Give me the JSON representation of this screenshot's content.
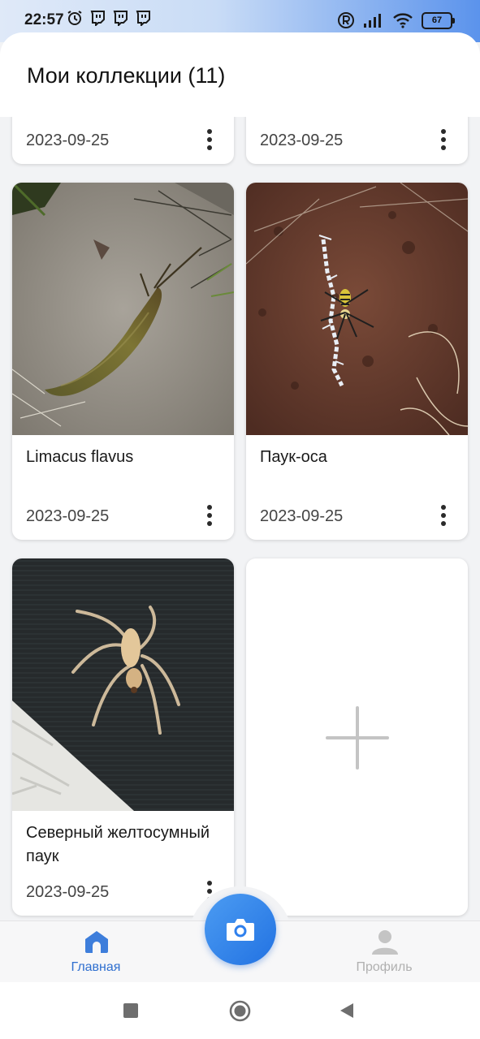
{
  "status_bar": {
    "time": "22:57",
    "battery": "67",
    "left_icons": [
      "alarm-icon",
      "twitch-icon",
      "twitch-icon",
      "twitch-icon"
    ],
    "right_icons": [
      "registered-icon",
      "signal-icon",
      "wifi-icon",
      "battery-icon"
    ]
  },
  "header": {
    "title": "Мои коллекции (11)"
  },
  "collections": [
    {
      "name": "",
      "date": "2023-09-25",
      "photo": "none"
    },
    {
      "name": "",
      "date": "2023-09-25",
      "photo": "none"
    },
    {
      "name": "Limacus flavus",
      "date": "2023-09-25",
      "photo": "slug"
    },
    {
      "name": "Паук-оса",
      "date": "2023-09-25",
      "photo": "wasp-spider"
    },
    {
      "name": "Северный желтосумный паук",
      "date": "2023-09-25",
      "photo": "yellow-sac-spider"
    }
  ],
  "add_card": {
    "icon": "plus-icon"
  },
  "bottom_nav": {
    "home_label": "Главная",
    "profile_label": "Профиль",
    "camera_icon": "camera-icon",
    "colors": {
      "active": "#2f6fcf",
      "inactive": "#b0b0b0",
      "fab": "#2f80ed"
    }
  },
  "system_nav": [
    "recents-icon",
    "home-icon",
    "back-icon"
  ]
}
